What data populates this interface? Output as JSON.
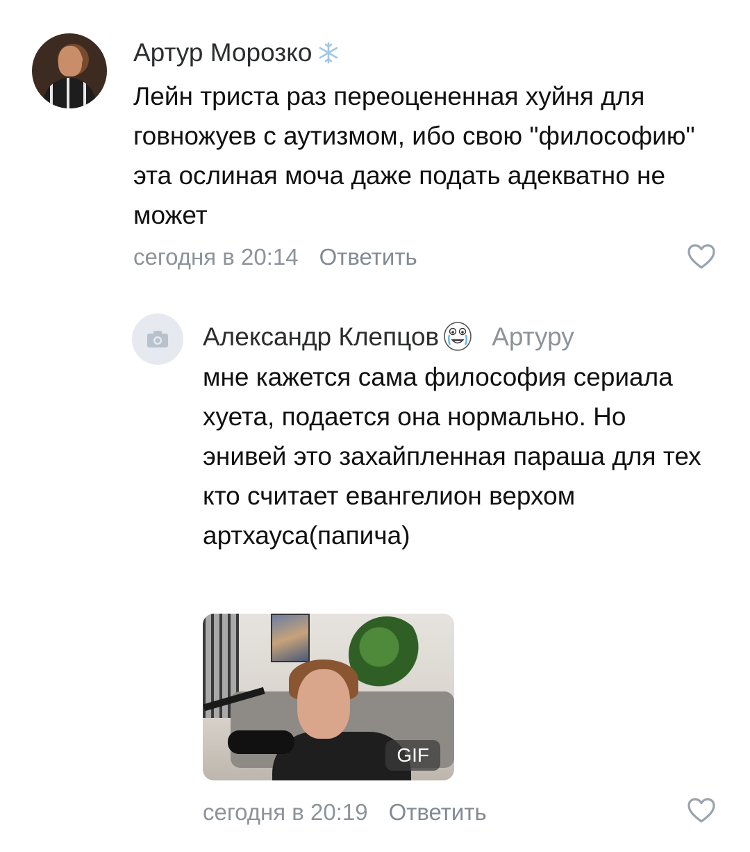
{
  "comment": {
    "author": "Артур Морозко",
    "author_badge_icon": "snowflake-icon",
    "text": "Лейн триста раз переоцененная хуйня для говножуев с аутизмом, ибо свою \"философию\" эта ослиная моча даже подать адекватно не может",
    "time": "сегодня в 20:14",
    "reply_label": "Ответить",
    "like_icon": "heart-icon"
  },
  "reply": {
    "author": "Александр Клепцов",
    "author_badge_icon": "crying-face-icon",
    "reply_to": "Артуру",
    "avatar_icon": "camera-icon",
    "text": "мне кажется сама философия сериала хуета, подается она нормально. Но энивей это захайпленная параша для тех кто считает евангелион верхом артхауса(папича)",
    "gif_label": "GIF",
    "time": "сегодня в 20:19",
    "reply_label": "Ответить",
    "like_icon": "heart-icon"
  },
  "colors": {
    "author": "#2c2d2e",
    "text": "#111111",
    "meta": "#8d9399",
    "avatar_placeholder": "#e6eaf0",
    "icon_gray": "#99a2ad"
  }
}
